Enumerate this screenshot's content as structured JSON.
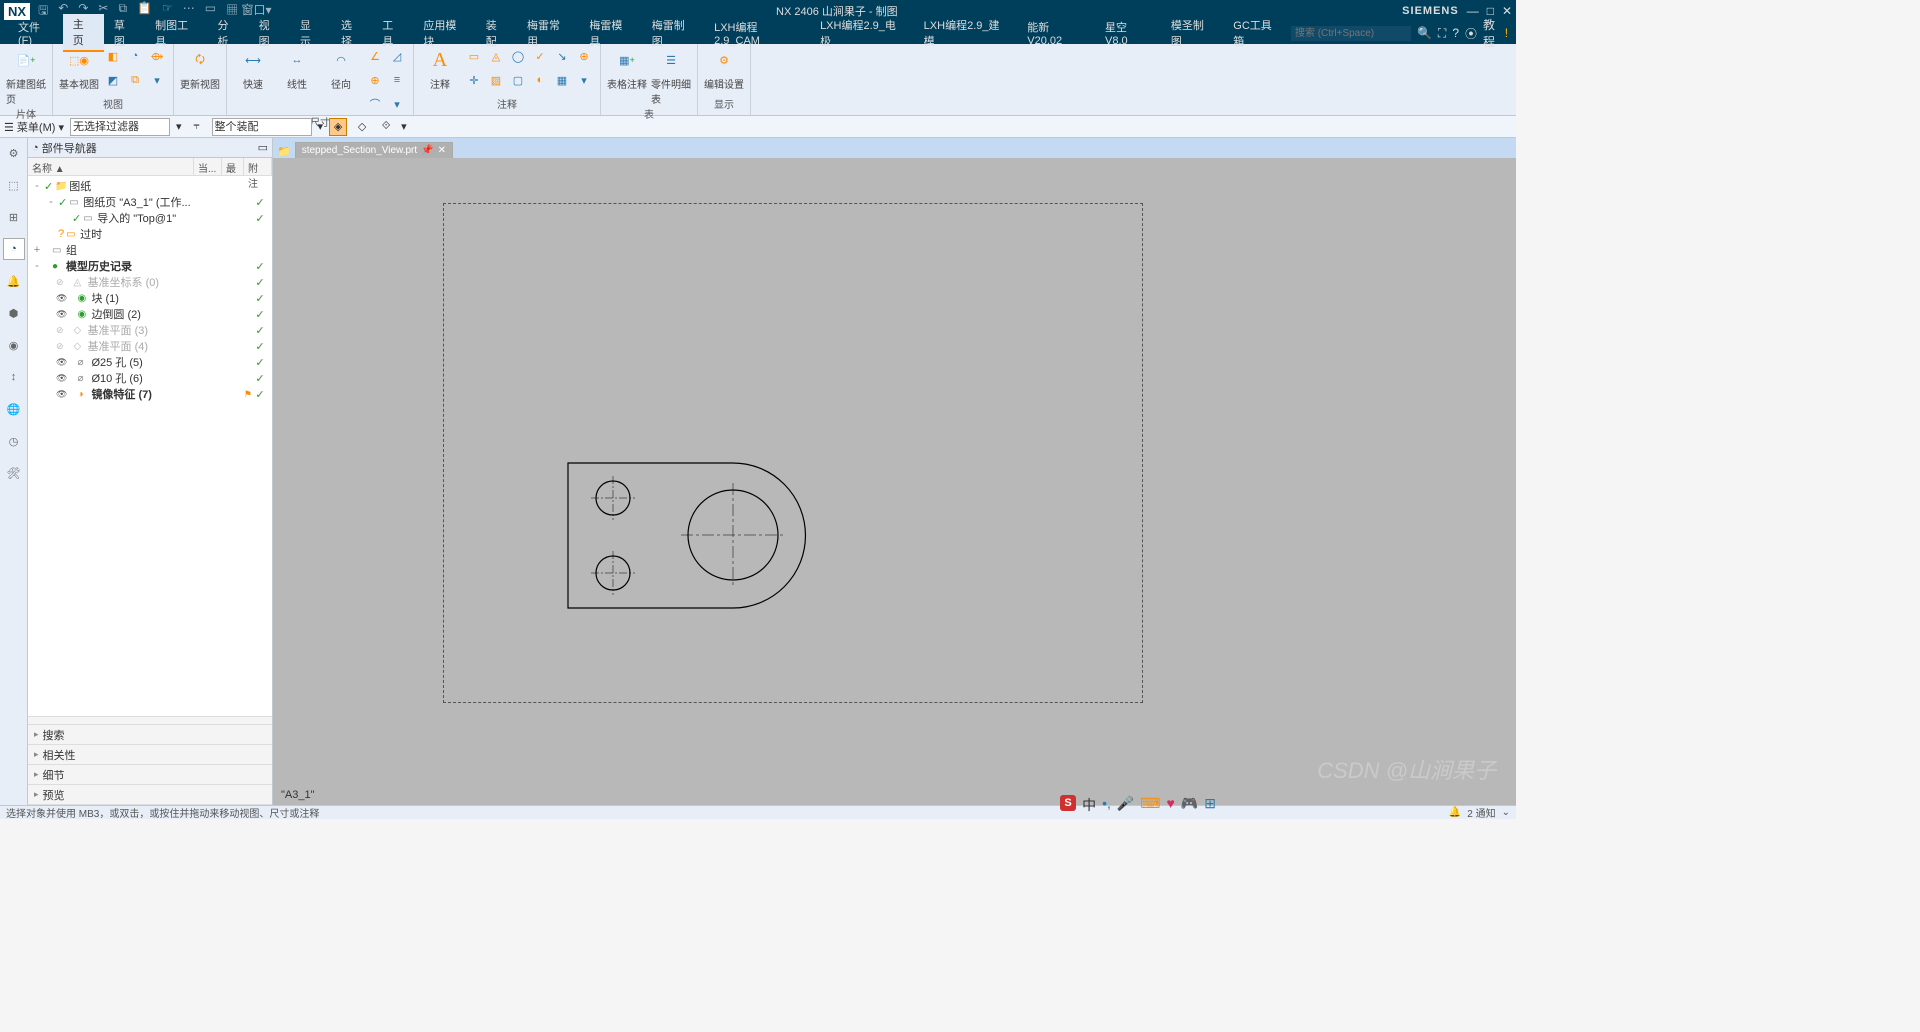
{
  "app": {
    "logo": "NX",
    "title": "NX 2406 山涧果子 - 制图",
    "brand": "SIEMENS"
  },
  "menubar": {
    "items": [
      "文件(F)",
      "主页",
      "草图",
      "制图工具",
      "分析",
      "视图",
      "显示",
      "选择",
      "工具",
      "应用模块",
      "装配",
      "梅雷常用",
      "梅雷模具",
      "梅雷制图",
      "LXH编程2.9_CAM",
      "LXH编程2.9_电极",
      "LXH编程2.9_建模",
      "能新 V20.02",
      "星空 V8.0",
      "模圣制图",
      "GC工具箱"
    ],
    "active_index": 1,
    "search_ph": "搜索 (Ctrl+Space)",
    "tutorial": "教程"
  },
  "ribbon": {
    "groups": [
      {
        "label": "片体",
        "big": [
          {
            "name": "new-sheet",
            "text": "新建图纸页"
          }
        ]
      },
      {
        "label": "视图",
        "big": [
          {
            "name": "base-view",
            "text": "基本视图"
          }
        ],
        "small": 6
      },
      {
        "label": "",
        "big": [
          {
            "name": "update-view",
            "text": "更新视图"
          }
        ]
      },
      {
        "label": "尺寸",
        "big": [
          {
            "name": "quick",
            "text": "快速"
          },
          {
            "name": "linear",
            "text": "线性"
          },
          {
            "name": "radial",
            "text": "径向"
          }
        ],
        "small": 6
      },
      {
        "label": "注释",
        "big": [
          {
            "name": "annot",
            "text": "注释"
          }
        ],
        "small": 12
      },
      {
        "label": "表",
        "big": [
          {
            "name": "table-annot",
            "text": "表格注释"
          },
          {
            "name": "parts-list",
            "text": "零件明细表"
          }
        ]
      },
      {
        "label": "显示",
        "big": [
          {
            "name": "edit-settings",
            "text": "编辑设置"
          }
        ]
      }
    ]
  },
  "subbar": {
    "menu": "菜单(M)",
    "filter": "无选择过滤器",
    "assembly": "整个装配"
  },
  "nav": {
    "title": "部件导航器",
    "cols": [
      "名称 ▲",
      "当...",
      "最",
      "附注"
    ],
    "tree": [
      {
        "d": 0,
        "exp": "-",
        "chk": "✓",
        "ico": "📁",
        "ico_color": "#ff8c00",
        "txt": "图纸",
        "upd": ""
      },
      {
        "d": 1,
        "exp": "-",
        "chk": "✓",
        "ico": "▭",
        "ico_color": "#888",
        "txt": "图纸页 \"A3_1\" (工作...",
        "upd": "✓"
      },
      {
        "d": 2,
        "exp": "",
        "chk": "✓",
        "ico": "▭",
        "ico_color": "#888",
        "txt": "导入的 \"Top@1\"",
        "upd": "✓"
      },
      {
        "d": 1,
        "exp": "",
        "chk": "?",
        "ico": "▭",
        "ico_color": "#ff8c00",
        "txt": "过时",
        "upd": ""
      },
      {
        "d": 0,
        "exp": "+",
        "chk": "",
        "ico": "▭",
        "ico_color": "#888",
        "txt": "组",
        "upd": ""
      },
      {
        "d": 0,
        "exp": "-",
        "chk": "",
        "ico": "●",
        "ico_color": "#2aa02a",
        "txt": "模型历史记录",
        "upd": "✓",
        "bold": true
      },
      {
        "d": 1,
        "exp": "",
        "chk": "",
        "ico": "◬",
        "ico_color": "#bbb",
        "txt": "基准坐标系 (0)",
        "upd": "✓",
        "gray": true,
        "eye": "⊘"
      },
      {
        "d": 1,
        "exp": "",
        "chk": "",
        "ico": "◉",
        "ico_color": "#2aa02a",
        "txt": "块 (1)",
        "upd": "✓",
        "eye": "👁"
      },
      {
        "d": 1,
        "exp": "",
        "chk": "",
        "ico": "◉",
        "ico_color": "#2aa02a",
        "txt": "边倒圆 (2)",
        "upd": "✓",
        "eye": "👁"
      },
      {
        "d": 1,
        "exp": "",
        "chk": "",
        "ico": "◇",
        "ico_color": "#bbb",
        "txt": "基准平面 (3)",
        "upd": "✓",
        "gray": true,
        "eye": "⊘"
      },
      {
        "d": 1,
        "exp": "",
        "chk": "",
        "ico": "◇",
        "ico_color": "#bbb",
        "txt": "基准平面 (4)",
        "upd": "✓",
        "gray": true,
        "eye": "⊘"
      },
      {
        "d": 1,
        "exp": "",
        "chk": "",
        "ico": "⌀",
        "ico_color": "#888",
        "txt": "Ø25 孔 (5)",
        "upd": "✓",
        "eye": "👁"
      },
      {
        "d": 1,
        "exp": "",
        "chk": "",
        "ico": "⌀",
        "ico_color": "#888",
        "txt": "Ø10 孔 (6)",
        "upd": "✓",
        "eye": "👁"
      },
      {
        "d": 1,
        "exp": "",
        "chk": "",
        "ico": "◑",
        "ico_color": "#ff8c00",
        "txt": "镜像特征 (7)",
        "upd": "✓",
        "bold": true,
        "eye": "👁",
        "flag": true
      }
    ],
    "acc": [
      "搜索",
      "相关性",
      "细节",
      "预览"
    ]
  },
  "tab": {
    "name": "stepped_Section_View.prt",
    "pin": "📌",
    "close": "✕"
  },
  "sheet_label": "\"A3_1\"",
  "status": {
    "left": "选择对象并使用 MB3，或双击，或按住并拖动来移动视图、尺寸或注释",
    "notif": "2 通知"
  },
  "watermark": "CSDN @山涧果子",
  "floatbar_text": "中"
}
